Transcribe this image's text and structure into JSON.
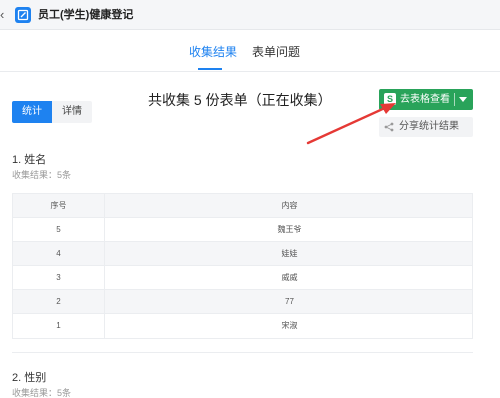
{
  "app": {
    "title": "员工(学生)健康登记"
  },
  "tabs": [
    {
      "label": "收集结果",
      "active": true
    },
    {
      "label": "表单问题",
      "active": false
    }
  ],
  "view_toggle": {
    "stats": "统计",
    "details": "详情"
  },
  "headline": "共收集 5 份表单（正在收集）",
  "actions": {
    "excel_label": "去表格查看",
    "share_label": "分享统计结果"
  },
  "questions": [
    {
      "title": "1. 姓名",
      "result": "收集结果：5条",
      "table": {
        "columns": [
          "序号",
          "内容"
        ],
        "rows": [
          [
            "5",
            "魏王爷"
          ],
          [
            "4",
            "娃娃"
          ],
          [
            "3",
            "威威"
          ],
          [
            "2",
            "77"
          ],
          [
            "1",
            "宋淑"
          ]
        ]
      }
    },
    {
      "title": "2. 性别",
      "result": "收集结果：5条"
    }
  ],
  "colors": {
    "accent": "#1e82f0",
    "excel_green": "#29a35a",
    "annotation_red": "#e53935"
  }
}
